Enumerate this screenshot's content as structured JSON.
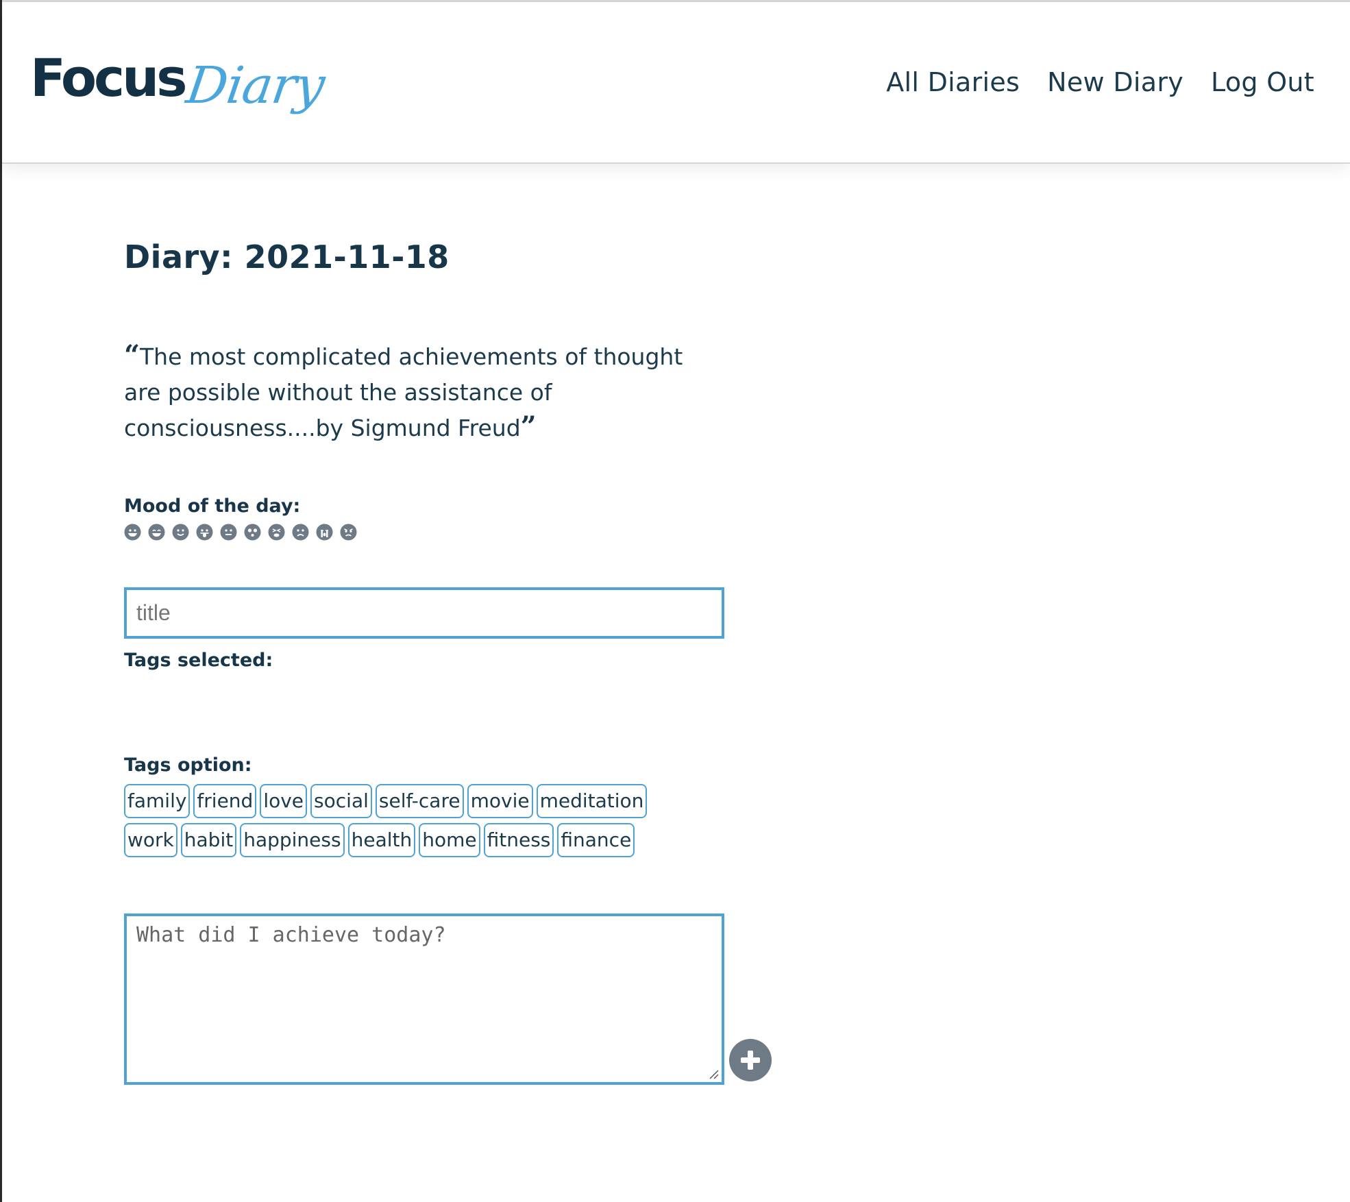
{
  "header": {
    "logo_primary": "Focus",
    "logo_secondary": "Diary",
    "nav": {
      "all_diaries": "All Diaries",
      "new_diary": "New Diary",
      "log_out": "Log Out"
    }
  },
  "main": {
    "page_title": "Diary: 2021-11-18",
    "quote": {
      "text": "The most complicated achievements of thought are possible without the assistance of consciousness....by Sigmund Freud",
      "open_mark": "“",
      "close_mark": "”"
    },
    "mood": {
      "label": "Mood of the day:",
      "icons": [
        "grin-icon",
        "grin-beam-icon",
        "smile-icon",
        "grin-tongue-icon",
        "meh-icon",
        "surprise-icon",
        "tired-icon",
        "frown-icon",
        "sad-cry-icon",
        "angry-icon"
      ]
    },
    "title_input": {
      "placeholder": "title",
      "value": ""
    },
    "tags_selected": {
      "label": "Tags selected:"
    },
    "tags_option": {
      "label": "Tags option:",
      "tags": [
        "family",
        "friend",
        "love",
        "social",
        "self-care",
        "movie",
        "meditation",
        "work",
        "habit",
        "happiness",
        "health",
        "home",
        "fitness",
        "finance"
      ]
    },
    "achievement_input": {
      "placeholder": "What did I achieve today?",
      "value": ""
    },
    "add_button_icon": "plus-circle-icon"
  },
  "colors": {
    "text_primary": "#1b3a4b",
    "accent_blue": "#4ea2d6",
    "logo_dark": "#143044",
    "logo_script": "#4aa6dc",
    "icon_gray": "#6e7a85"
  }
}
